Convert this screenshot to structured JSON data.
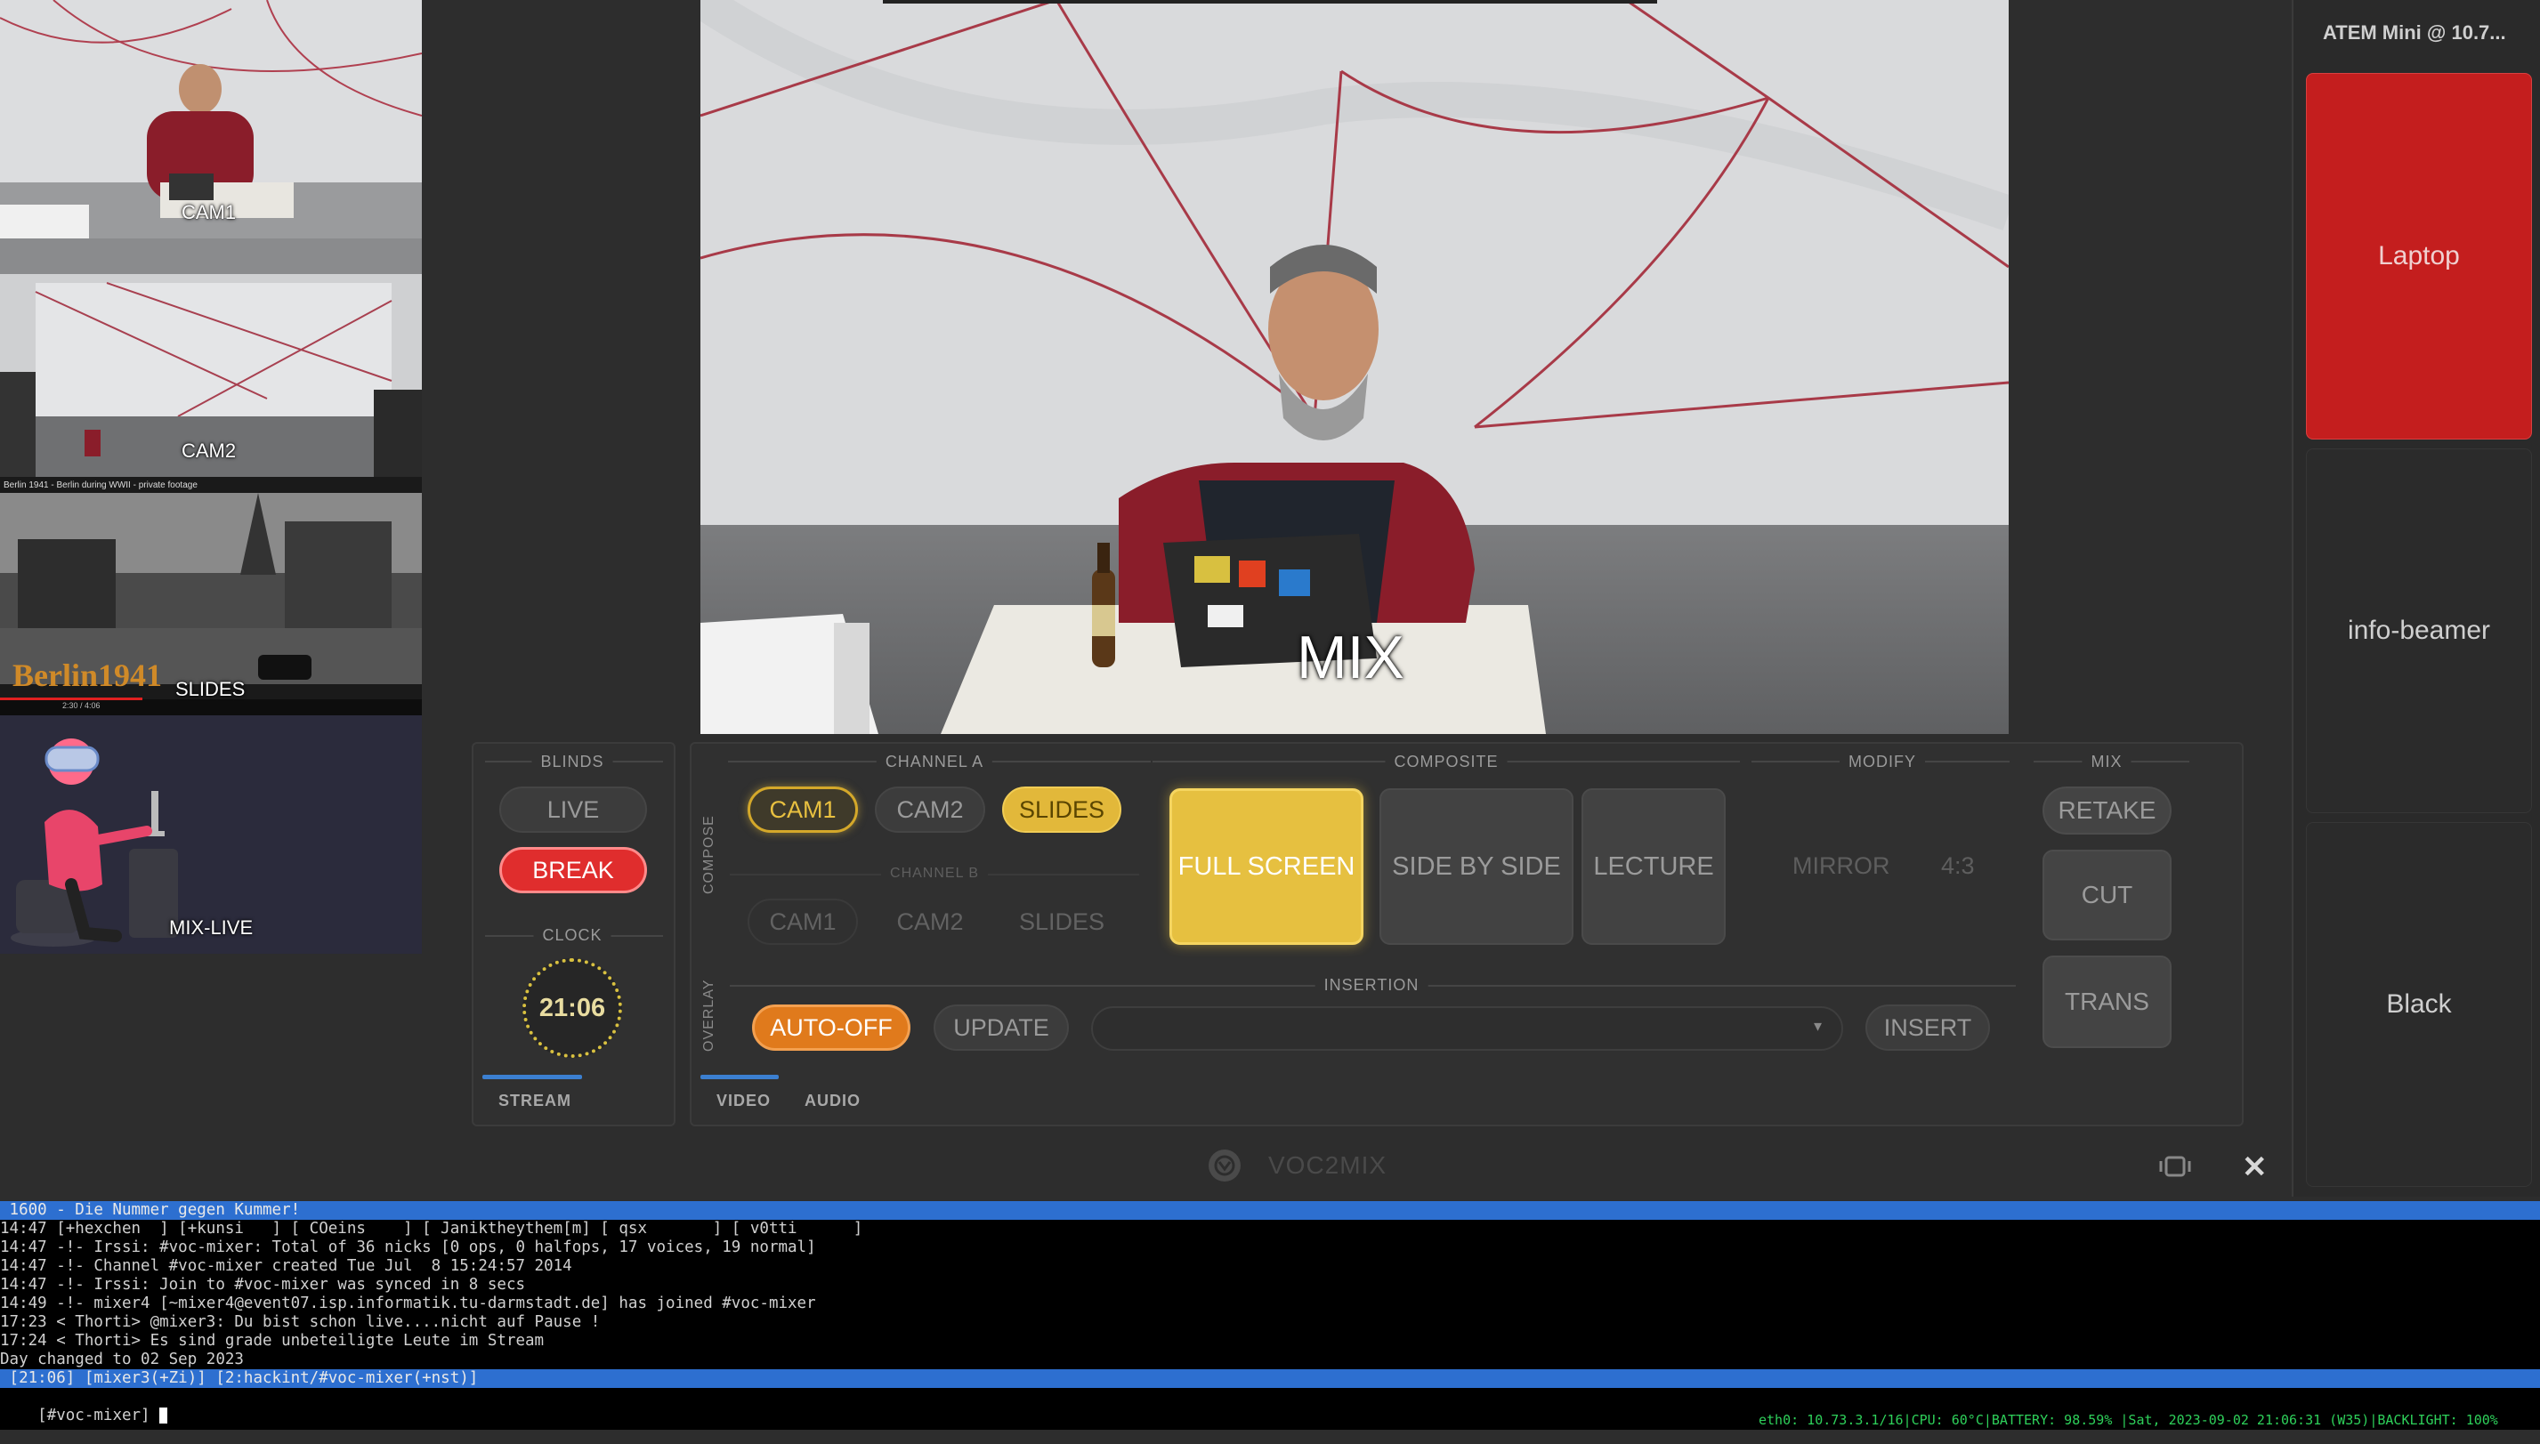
{
  "previews": [
    {
      "label": "CAM1"
    },
    {
      "label": "CAM2"
    },
    {
      "label": "SLIDES",
      "title": "Berlin 1941 - Berlin during WWII - private footage",
      "overlay_text": "Berlin1941",
      "time": "2:30 / 4:06"
    },
    {
      "label": "MIX-LIVE"
    }
  ],
  "main_view": {
    "label": "MIX"
  },
  "atem": {
    "title": "ATEM Mini @ 10.7...",
    "buttons": [
      {
        "label": "Laptop",
        "color": "#c41e1e"
      },
      {
        "label": "info-beamer"
      },
      {
        "label": "Black"
      }
    ]
  },
  "blinds": {
    "section": "BLINDS",
    "live": "LIVE",
    "break": "BREAK"
  },
  "clock": {
    "section": "CLOCK",
    "time": "21:06"
  },
  "stream_tab": "STREAM",
  "compose": {
    "vertical_label": "COMPOSE",
    "channel_a": {
      "label": "CHANNEL A",
      "sources": [
        "CAM1",
        "CAM2",
        "SLIDES"
      ]
    },
    "channel_b": {
      "label": "CHANNEL B",
      "sources": [
        "CAM1",
        "CAM2",
        "SLIDES"
      ]
    },
    "composite": {
      "label": "COMPOSITE",
      "buttons": [
        "FULL SCREEN",
        "SIDE BY SIDE",
        "LECTURE"
      ]
    },
    "modify": {
      "label": "MODIFY",
      "buttons": [
        "MIRROR",
        "4:3"
      ]
    },
    "mix": {
      "label": "MIX",
      "buttons": [
        "RETAKE",
        "CUT",
        "TRANS"
      ]
    }
  },
  "overlay": {
    "vertical_label": "OVERLAY",
    "section": "INSERTION",
    "auto_off": "AUTO-OFF",
    "update": "UPDATE",
    "insert": "INSERT",
    "select_value": ""
  },
  "tabs": [
    "VIDEO",
    "AUDIO"
  ],
  "app": {
    "name": "VOC2MIX"
  },
  "terminal": {
    "topic": " 1600 - Die Nummer gegen Kummer!",
    "lines": [
      "14:47 [+hexchen  ] [+kunsi   ] [ COeins    ] [ Janiktheythem[m] [ qsx       ] [ v0tti      ]",
      "14:47 -!- Irssi: #voc-mixer: Total of 36 nicks [0 ops, 0 halfops, 17 voices, 19 normal]",
      "14:47 -!- Channel #voc-mixer created Tue Jul  8 15:24:57 2014",
      "14:47 -!- Irssi: Join to #voc-mixer was synced in 8 secs",
      "14:49 -!- mixer4 [~mixer4@event07.isp.informatik.tu-darmstadt.de] has joined #voc-mixer",
      "17:23 < Thorti> @mixer3: Du bist schon live....nicht auf Pause !",
      "17:24 < Thorti> Es sind grade unbeteiligte Leute im Stream",
      "Day changed to 02 Sep 2023"
    ],
    "statusline": " [21:06] [mixer3(+Zi)] [2:hackint/#voc-mixer(+nst)]",
    "prompt": "[#voc-mixer] "
  },
  "system_status": "eth0: 10.73.3.1/16|CPU: 60°C|BATTERY: 98.59% |Sat, 2023-09-02 21:06:31 (W35)|BACKLIGHT: 100%"
}
